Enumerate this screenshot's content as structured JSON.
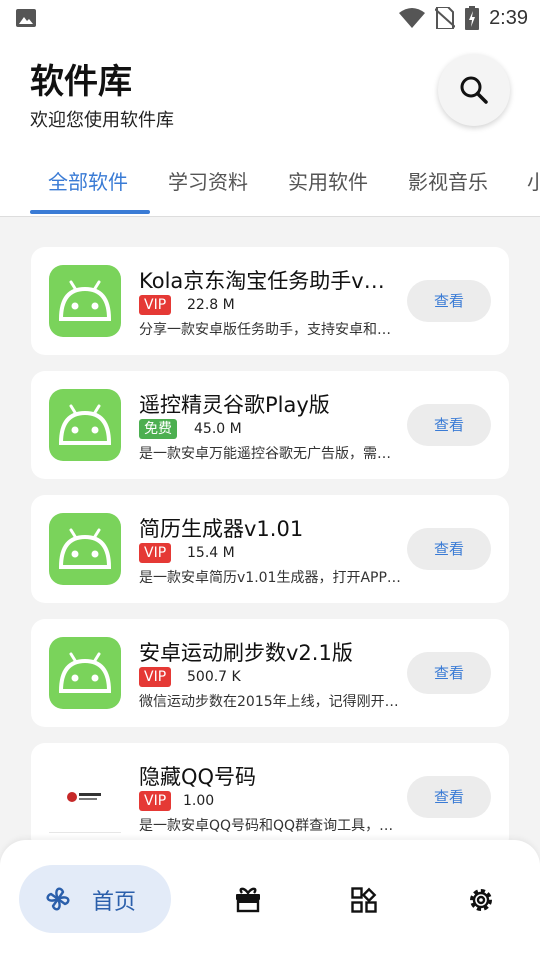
{
  "status_bar": {
    "time": "2:39",
    "left_icon": "image-icon",
    "right_icons": [
      "wifi-icon",
      "no-sim-icon",
      "battery-charging-icon"
    ]
  },
  "header": {
    "title": "软件库",
    "subtitle": "欢迎您使用软件库",
    "search_icon": "search-icon"
  },
  "tabs": [
    {
      "label": "全部软件",
      "active": true
    },
    {
      "label": "学习资料",
      "active": false
    },
    {
      "label": "实用软件",
      "active": false
    },
    {
      "label": "影视音乐",
      "active": false
    },
    {
      "label": "小",
      "active": false
    }
  ],
  "apps": [
    {
      "name": "Kola京东淘宝任务助手v3…",
      "badge": "VIP",
      "size": "22.8 M",
      "desc": "分享一款安卓版任务助手，支持安卓和…",
      "button": "查看",
      "icon": "android-icon"
    },
    {
      "name": "遥控精灵谷歌Play版",
      "badge": "免费",
      "size": "45.0 M",
      "desc": "是一款安卓万能遥控谷歌无广告版，需…",
      "button": "查看",
      "icon": "android-icon"
    },
    {
      "name": "简历生成器v1.01",
      "badge": "VIP",
      "size": "15.4 M",
      "desc": "是一款安卓简历v1.01生成器，打开APP…",
      "button": "查看",
      "icon": "android-icon"
    },
    {
      "name": "安卓运动刷步数v2.1版",
      "badge": "VIP",
      "size": "500.7 K",
      "desc": "微信运动步数在2015年上线，记得刚开…",
      "button": "查看",
      "icon": "android-icon"
    },
    {
      "name": "隐藏QQ号码",
      "badge": "VIP",
      "size": "1.00",
      "desc": "是一款安卓QQ号码和QQ群查询工具，…",
      "button": "查看",
      "icon": "logo-icon"
    }
  ],
  "bottom_nav": {
    "home_label": "首页",
    "items": [
      "pinwheel-icon",
      "gift-icon",
      "apps-icon",
      "settings-icon"
    ]
  },
  "colors": {
    "accent": "#3a7bd5",
    "vip": "#e53935",
    "free": "#4caf50",
    "android": "#7ad35b"
  }
}
